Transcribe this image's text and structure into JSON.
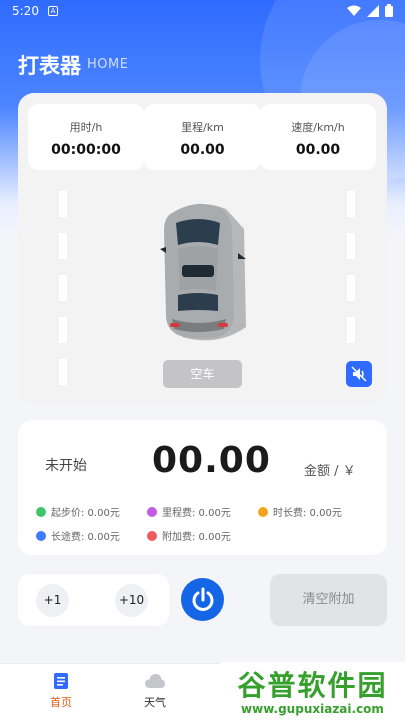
{
  "status_bar": {
    "time": "5:20",
    "a_icon": "A"
  },
  "header": {
    "title": "打表器",
    "subtitle": "HOME"
  },
  "stats": [
    {
      "label": "用时/h",
      "value": "00:00:00"
    },
    {
      "label": "里程/km",
      "value": "00.00"
    },
    {
      "label": "速度/km/h",
      "value": "00.00"
    }
  ],
  "car_panel": {
    "vacant_label": "空车"
  },
  "fare": {
    "status": "未开始",
    "amount": "00.00",
    "unit": "金额 / ￥",
    "items": [
      {
        "label": "起步价: 0.00元",
        "color": "#3ec46d"
      },
      {
        "label": "里程费: 0.00元",
        "color": "#c35ae6"
      },
      {
        "label": "时长费: 0.00元",
        "color": "#f5a31a"
      },
      {
        "label": "长途费: 0.00元",
        "color": "#3d7bff"
      },
      {
        "label": "附加费: 0.00元",
        "color": "#f05a5a"
      }
    ]
  },
  "controls": {
    "plus_one": "+1",
    "plus_ten": "+10",
    "clear_extra": "清空附加"
  },
  "nav": {
    "home": "首页",
    "weather": "天气"
  },
  "watermark": {
    "main": "谷普软件园",
    "sub": "www.gupuxiazai.com"
  },
  "colors": {
    "primary": "#2f6bff",
    "power": "#1566e6",
    "inactive": "#c4c4c6"
  }
}
